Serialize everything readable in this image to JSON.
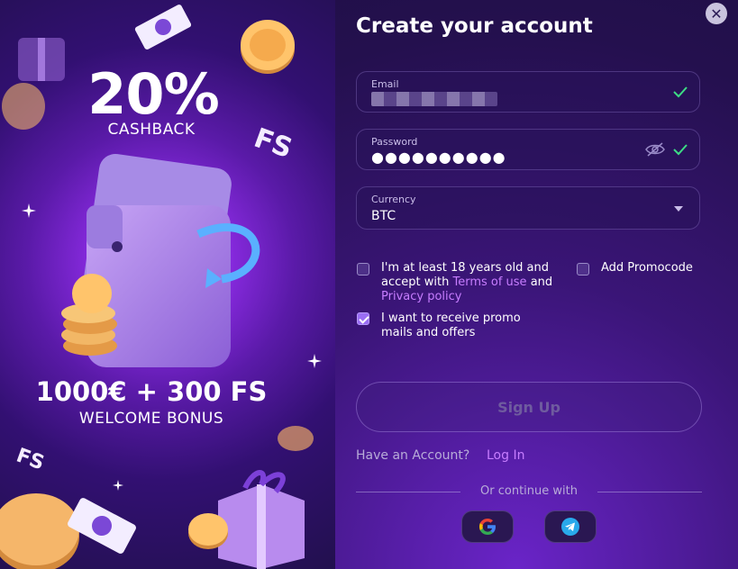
{
  "promo": {
    "cashback_value": "20%",
    "cashback_label": "CASHBACK",
    "bonus_value": "1000€ + 300 FS",
    "bonus_label": "WELCOME BONUS",
    "fs_badge": "FS"
  },
  "form": {
    "title": "Create your account",
    "email": {
      "label": "Email",
      "value": ""
    },
    "password": {
      "label": "Password",
      "value": "●●●●●●●●●●"
    },
    "currency": {
      "label": "Currency",
      "value": "BTC"
    },
    "age_checkbox": {
      "checked": false,
      "text_1": "I'm at least 18 years old and accept with ",
      "terms_link": "Terms of use",
      "text_2": " and",
      "privacy_link": "Privacy policy"
    },
    "promocode_checkbox": {
      "checked": false,
      "label": "Add Promocode"
    },
    "promo_mails_checkbox": {
      "checked": true,
      "label": "I want to receive promo mails and offers"
    },
    "signup_label": "Sign Up",
    "have_account": "Have an Account?",
    "login_label": "Log In",
    "continue_with": "Or continue with",
    "socials": [
      "google-icon",
      "telegram-icon"
    ]
  },
  "colors": {
    "accent": "#c77dff",
    "check_green": "#3ddc84",
    "checkbox_on": "#9b6ef5"
  }
}
